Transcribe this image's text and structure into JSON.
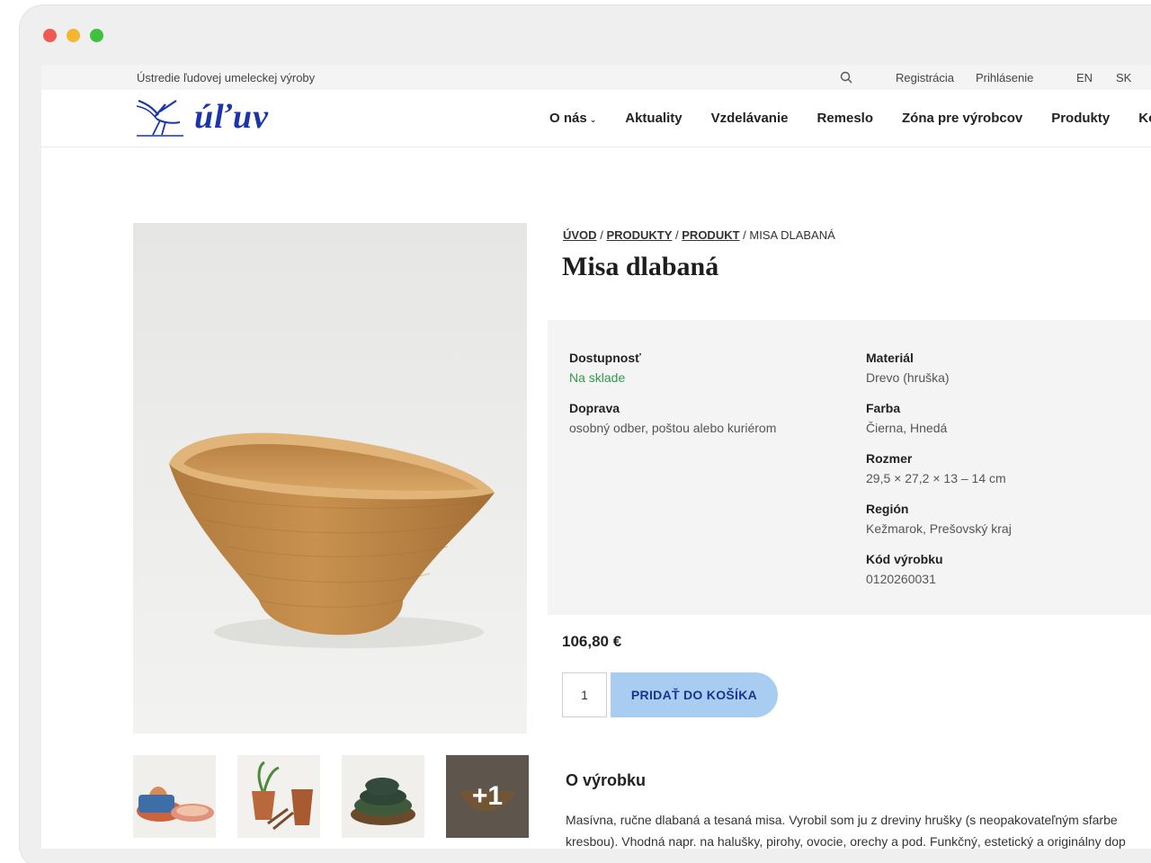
{
  "window": {
    "controls": [
      "close",
      "minimize",
      "maximize"
    ]
  },
  "topbar": {
    "org_name": "Ústredie ľudovej umeleckej výroby",
    "search_icon": "search-icon",
    "register_label": "Registrácia",
    "login_label": "Prihlásenie",
    "lang_en": "EN",
    "lang_sk": "SK"
  },
  "header": {
    "logo_text": "úľuv",
    "nav": [
      {
        "label": "O nás",
        "has_dropdown": true
      },
      {
        "label": "Aktuality"
      },
      {
        "label": "Vzdelávanie"
      },
      {
        "label": "Remeslo"
      },
      {
        "label": "Zóna pre výrobcov"
      },
      {
        "label": "Produkty"
      },
      {
        "label": "Konta"
      }
    ]
  },
  "breadcrumb": {
    "items": [
      "ÚVOD",
      "PRODUKTY",
      "PRODUKT"
    ],
    "current": "MISA DLABANÁ",
    "separator": "/"
  },
  "product": {
    "title": "Misa dlabaná",
    "availability_label": "Dostupnosť",
    "availability_value": "Na sklade",
    "shipping_label": "Doprava",
    "shipping_value": "osobný odber, poštou alebo kuriérom",
    "material_label": "Materiál",
    "material_value": "Drevo (hruška)",
    "color_label": "Farba",
    "color_value": "Čierna, Hnedá",
    "size_label": "Rozmer",
    "size_value": "29,5 × 27,2 × 13 – 14 cm",
    "region_label": "Región",
    "region_value": "Kežmarok, Prešovský kraj",
    "code_label": "Kód výrobku",
    "code_value": "0120260031",
    "price": "106,80 €",
    "quantity": "1",
    "add_to_cart_label": "PRIDAŤ DO KOŠÍKA",
    "more_images_label": "+1",
    "about_title": "O výrobku",
    "about_line1": "Masívna, ručne dlabaná a tesaná misa. Vyrobil som ju z dreviny hrušky (s neopakovateľným sfarbe",
    "about_line2": "kresbou). Vhodná napr. na halušky, pirohy, ovocie, orechy a pod. Funkčný, estetický a originálny dop"
  },
  "colors": {
    "brand_blue": "#1a35a8",
    "button_bg": "#a9cdf1",
    "in_stock_green": "#2f9a4c"
  }
}
